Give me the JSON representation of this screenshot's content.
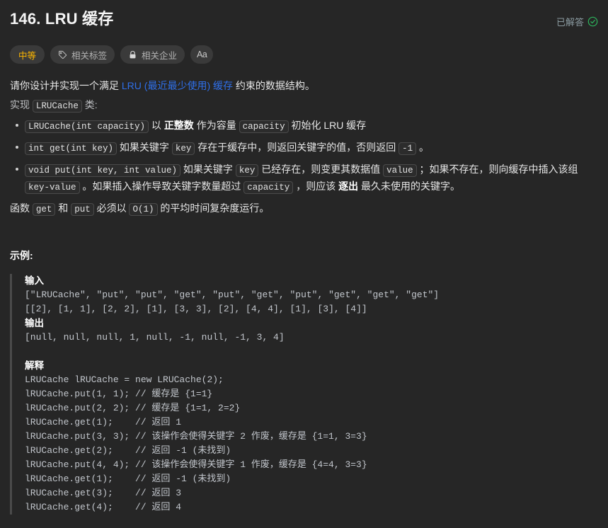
{
  "header": {
    "title": "146. LRU 缓存",
    "status_label": "已解答",
    "status_icon": "check-circle-icon",
    "status_color": "#2db55d"
  },
  "meta": {
    "difficulty": {
      "label": "中等",
      "color": "#ffb800"
    },
    "topics": {
      "label": "相关标签",
      "icon": "tag-icon"
    },
    "companies": {
      "label": "相关企业",
      "icon": "lock-icon"
    },
    "font_size": {
      "label": "Aa",
      "icon": "font-size-icon"
    }
  },
  "description": {
    "lead_before": "请你设计并实现一个满足 ",
    "lead_link": "LRU (最近最少使用) 缓存",
    "lead_after": " 约束的数据结构。",
    "implement_before": "实现 ",
    "implement_class": "LRUCache",
    "implement_after": " 类:",
    "bullets": [
      {
        "parts": [
          {
            "type": "code",
            "text": "LRUCache(int capacity)"
          },
          {
            "type": "text",
            "text": " 以 "
          },
          {
            "type": "bold",
            "text": "正整数"
          },
          {
            "type": "text",
            "text": " 作为容量 "
          },
          {
            "type": "code",
            "text": "capacity"
          },
          {
            "type": "text",
            "text": " 初始化 LRU 缓存"
          }
        ]
      },
      {
        "parts": [
          {
            "type": "code",
            "text": "int get(int key)"
          },
          {
            "type": "text",
            "text": " 如果关键字 "
          },
          {
            "type": "code",
            "text": "key"
          },
          {
            "type": "text",
            "text": " 存在于缓存中，则返回关键字的值，否则返回 "
          },
          {
            "type": "code",
            "text": "-1"
          },
          {
            "type": "text",
            "text": " 。"
          }
        ]
      },
      {
        "parts": [
          {
            "type": "code",
            "text": "void put(int key, int value)"
          },
          {
            "type": "text",
            "text": " 如果关键字 "
          },
          {
            "type": "code",
            "text": "key"
          },
          {
            "type": "text",
            "text": " 已经存在，则变更其数据值 "
          },
          {
            "type": "code",
            "text": "value"
          },
          {
            "type": "text",
            "text": " ；如果不存在，则向缓存中插入该组 "
          },
          {
            "type": "code",
            "text": "key-value"
          },
          {
            "type": "text",
            "text": " 。如果插入操作导致关键字数量超过 "
          },
          {
            "type": "code",
            "text": "capacity"
          },
          {
            "type": "text",
            "text": " ，则应该 "
          },
          {
            "type": "bold",
            "text": "逐出"
          },
          {
            "type": "text",
            "text": " 最久未使用的关键字。"
          }
        ]
      }
    ],
    "complexity_parts": [
      {
        "type": "text",
        "text": "函数 "
      },
      {
        "type": "code",
        "text": "get"
      },
      {
        "type": "text",
        "text": " 和 "
      },
      {
        "type": "code",
        "text": "put"
      },
      {
        "type": "text",
        "text": " 必须以 "
      },
      {
        "type": "code",
        "text": "O(1)"
      },
      {
        "type": "text",
        "text": " 的平均时间复杂度运行。"
      }
    ]
  },
  "example": {
    "heading": "示例:",
    "input_label": "输入",
    "input_lines": "[\"LRUCache\", \"put\", \"put\", \"get\", \"put\", \"get\", \"put\", \"get\", \"get\", \"get\"]\n[[2], [1, 1], [2, 2], [1], [3, 3], [2], [4, 4], [1], [3], [4]]",
    "output_label": "输出",
    "output_lines": "[null, null, null, 1, null, -1, null, -1, 3, 4]",
    "explain_label": "解释",
    "explain_lines": "LRUCache lRUCache = new LRUCache(2);\nlRUCache.put(1, 1); // 缓存是 {1=1}\nlRUCache.put(2, 2); // 缓存是 {1=1, 2=2}\nlRUCache.get(1);    // 返回 1\nlRUCache.put(3, 3); // 该操作会使得关键字 2 作废，缓存是 {1=1, 3=3}\nlRUCache.get(2);    // 返回 -1 (未找到)\nlRUCache.put(4, 4); // 该操作会使得关键字 1 作废，缓存是 {4=4, 3=3}\nlRUCache.get(1);    // 返回 -1 (未找到)\nlRUCache.get(3);    // 返回 3\nlRUCache.get(4);    // 返回 4"
  }
}
